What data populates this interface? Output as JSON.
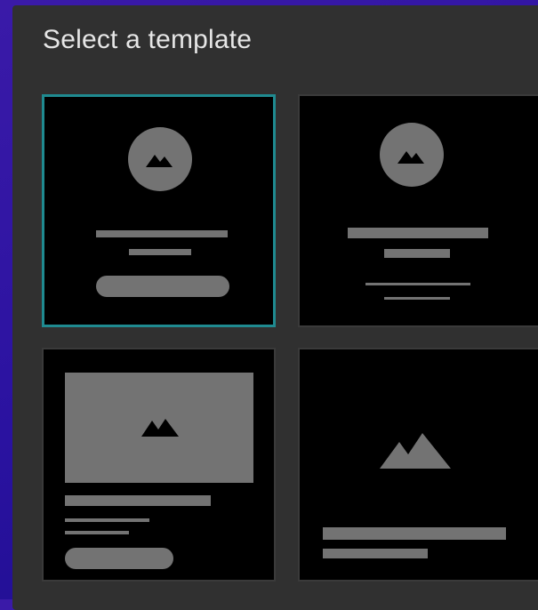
{
  "dialog": {
    "title": "Select a template"
  },
  "templates": [
    {
      "selected": true,
      "icons": [
        "image-icon"
      ]
    },
    {
      "selected": false,
      "icons": [
        "image-icon"
      ]
    },
    {
      "selected": false,
      "icons": [
        "image-icon"
      ]
    },
    {
      "selected": false,
      "icons": [
        "image-icon"
      ]
    }
  ],
  "colors": {
    "background": "#2a12a0",
    "panel": "#303030",
    "card": "#000000",
    "placeholder": "#737373",
    "selected_border": "#1f8a90",
    "title_text": "#e6e6e6"
  }
}
